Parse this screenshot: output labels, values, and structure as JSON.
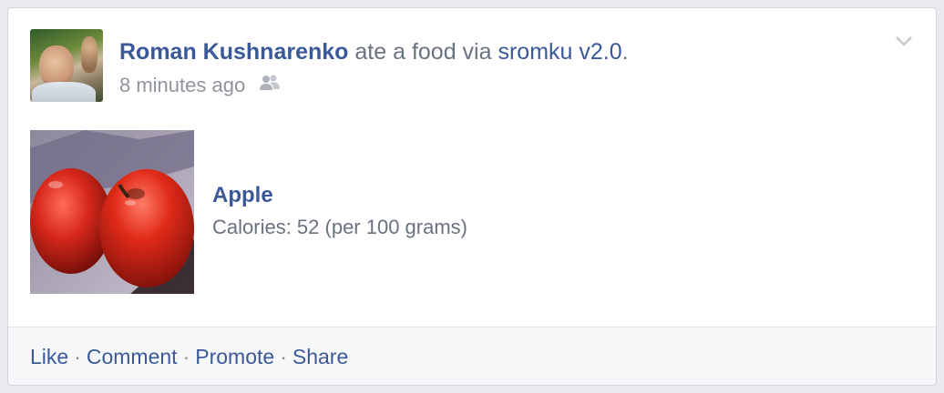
{
  "post": {
    "author": "Roman Kushnarenko",
    "action_text": "ate a food via",
    "app": "sromku v2.0",
    "period": ".",
    "timestamp": "8 minutes ago",
    "audience_icon": "friends-icon",
    "menu_icon": "chevron-down-icon"
  },
  "attachment": {
    "image": "apple-photo",
    "title": "Apple",
    "description": "Calories: 52 (per 100 grams)"
  },
  "actions": {
    "like": "Like",
    "comment": "Comment",
    "promote": "Promote",
    "share": "Share",
    "separator": "·"
  },
  "colors": {
    "link_blue": "#3b5998",
    "meta_gray": "#90949c",
    "text_gray": "#6a7180",
    "footer_bg": "#f6f7f9"
  }
}
